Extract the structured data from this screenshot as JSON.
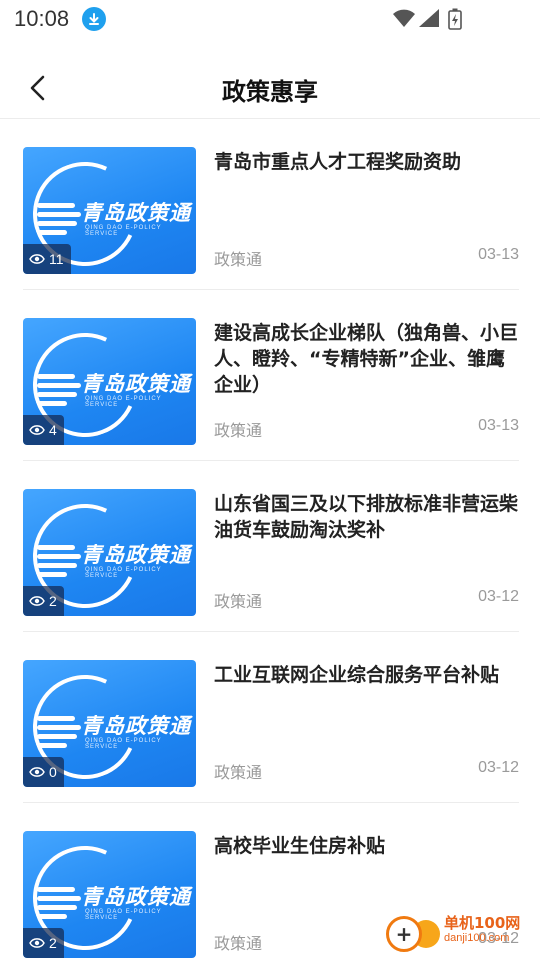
{
  "status_bar": {
    "time": "10:08"
  },
  "header": {
    "title": "政策惠享"
  },
  "articles": [
    {
      "title": "青岛市重点人才工程奖励资助",
      "views": "11",
      "source": "政策通",
      "date": "03-13",
      "brand": "青岛政策通",
      "brand_sub": "QING DAO E-POLICY SERVICE"
    },
    {
      "title": "建设高成长企业梯队（独角兽、小巨人、瞪羚、“专精特新”企业、雏鹰企业）",
      "views": "4",
      "source": "政策通",
      "date": "03-13",
      "brand": "青岛政策通",
      "brand_sub": "QING DAO E-POLICY SERVICE"
    },
    {
      "title": "山东省国三及以下排放标准非营运柴油货车鼓励淘汰奖补",
      "views": "2",
      "source": "政策通",
      "date": "03-12",
      "brand": "青岛政策通",
      "brand_sub": "QING DAO E-POLICY SERVICE"
    },
    {
      "title": "工业互联网企业综合服务平台补贴",
      "views": "0",
      "source": "政策通",
      "date": "03-12",
      "brand": "青岛政策通",
      "brand_sub": "QING DAO E-POLICY SERVICE"
    },
    {
      "title": "高校毕业生住房补贴",
      "views": "2",
      "source": "政策通",
      "date": "03-12",
      "brand": "青岛政策通",
      "brand_sub": "QING DAO E-POLICY SERVICE"
    }
  ],
  "watermark": {
    "text": "单机100网",
    "url": "danji100.com"
  },
  "colors": {
    "accent": "#1e86f2",
    "download_badge": "#1fa0ee",
    "watermark": "#e8631a"
  }
}
